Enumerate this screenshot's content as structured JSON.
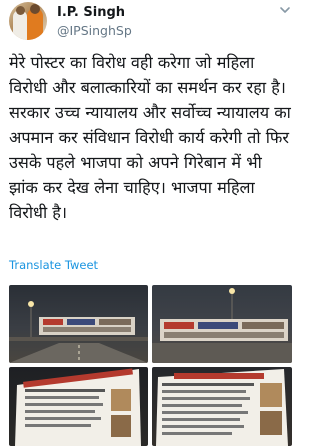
{
  "tweet": {
    "display_name": "I.P. Singh",
    "handle": "@IPSinghSp",
    "text": "मेरे पोस्टर का विरोध वही करेगा जो महिला विरोधी और बलात्कारियों का समर्थन कर रहा है। सरकार उच्च न्यायालय और सर्वोच्च न्यायालय का अपमान कर संविधान विरोधी कार्य करेगी तो फिर उसके पहले भाजपा को अपने गिरेबान में भी झांक कर देख लेना चाहिए। भाजपा महिला विरोधी है।",
    "translate_label": "Translate Tweet"
  },
  "media": {
    "count": 4,
    "photos": [
      {
        "subject": "roadside-hoarding-night"
      },
      {
        "subject": "roadside-hoarding-night"
      },
      {
        "subject": "poster-closeup"
      },
      {
        "subject": "poster-closeup"
      }
    ]
  },
  "colors": {
    "link": "#1b95e0",
    "secondary_text": "#657786",
    "primary_text": "#14171a"
  },
  "icons": [
    "chevron-down-icon"
  ]
}
